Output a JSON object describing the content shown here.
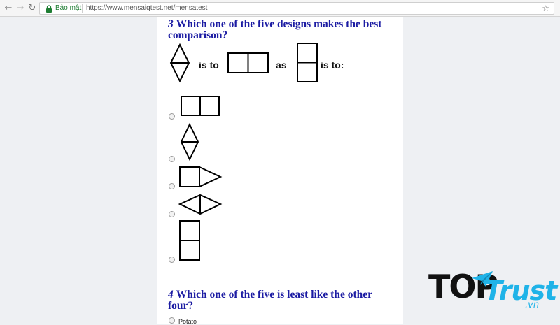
{
  "browser": {
    "secure_label": "Bảo mật",
    "url": "https://www.mensaiqtest.net/mensatest",
    "icons": {
      "back": "back-arrow-icon",
      "forward": "forward-arrow-icon",
      "reload": "reload-icon",
      "lock": "lock-icon",
      "bookmark": "star-icon"
    }
  },
  "questions": [
    {
      "number": "3",
      "title": "Which one of the five designs makes the best comparison?",
      "stem": {
        "word_1": "is to",
        "word_2": "as",
        "word_3": "is to:",
        "shapes": [
          "vertical-diamond-split",
          "two-squares-horizontal",
          "two-squares-vertical"
        ]
      },
      "options": [
        {
          "shape": "two-squares-horizontal"
        },
        {
          "shape": "vertical-diamond-split"
        },
        {
          "shape": "square-with-triangle"
        },
        {
          "shape": "horizontal-diamond-split"
        },
        {
          "shape": "two-squares-vertical"
        }
      ]
    },
    {
      "number": "4",
      "title": "Which one of the five is least like the other four?",
      "options": [
        {
          "label": "Potato"
        }
      ]
    }
  ],
  "watermark": {
    "top": "TOP",
    "trust": "Trust",
    "vn": ".vn"
  },
  "colors": {
    "question_title": "#1c1ca3",
    "watermark_blue": "#1fb3e8",
    "secure_green": "#1e7d32"
  }
}
